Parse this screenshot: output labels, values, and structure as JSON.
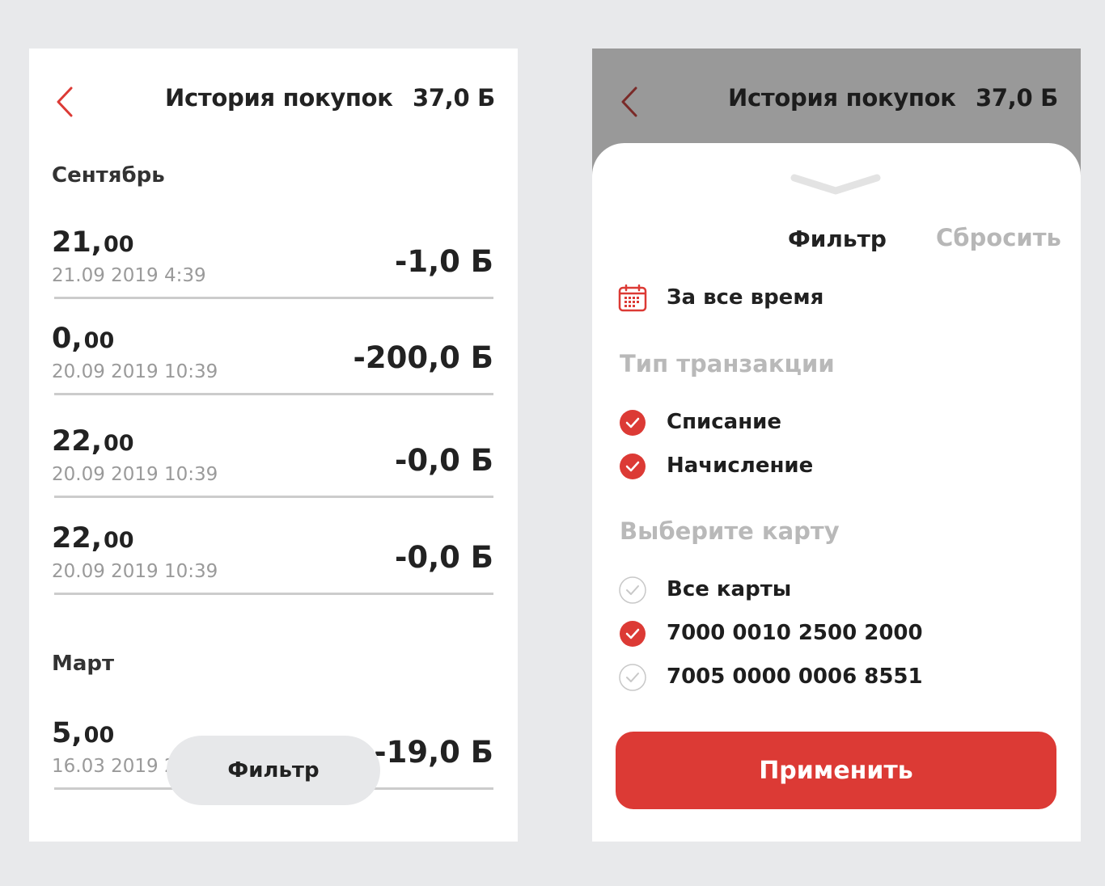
{
  "header": {
    "title": "История покупок",
    "balance": "37,0 Б"
  },
  "history": {
    "sections": [
      {
        "title": "Сентябрь",
        "items": [
          {
            "number": "21,",
            "decimals": "00",
            "date": "21.09 2019 4:39",
            "amount": "-1,0 Б"
          },
          {
            "number": "0,",
            "decimals": "00",
            "date": "20.09 2019 10:39",
            "amount": "-200,0 Б"
          },
          {
            "number": "22,",
            "decimals": "00",
            "date": "20.09 2019 10:39",
            "amount": "-0,0 Б"
          },
          {
            "number": "22,",
            "decimals": "00",
            "date": "20.09 2019 10:39",
            "amount": "-0,0 Б"
          }
        ]
      },
      {
        "title": "Март",
        "items": [
          {
            "number": "5,",
            "decimals": "00",
            "date": "16.03 2019 2",
            "amount": "-19,0 Б"
          }
        ]
      }
    ],
    "filter_button": "Фильтр"
  },
  "filter": {
    "title": "Фильтр",
    "reset": "Сбросить",
    "period": "За все время",
    "transaction_type_title": "Тип транзакции",
    "transaction_types": [
      {
        "label": "Списание",
        "checked": true
      },
      {
        "label": "Начисление",
        "checked": true
      }
    ],
    "card_title": "Выберите карту",
    "cards": [
      {
        "label": "Все карты",
        "checked": false
      },
      {
        "label": "7000 0010 2500 2000",
        "checked": true
      },
      {
        "label": "7005 0000 0006 8551",
        "checked": false
      }
    ],
    "apply": "Применить"
  },
  "colors": {
    "accent": "#dc3a35",
    "overlay": "#999999",
    "muted_text": "#9a9a9a",
    "page_background": "#e8e9eb"
  },
  "icons": [
    "back-chevron-icon",
    "calendar-icon",
    "check-circle-icon",
    "sheet-handle-icon"
  ]
}
